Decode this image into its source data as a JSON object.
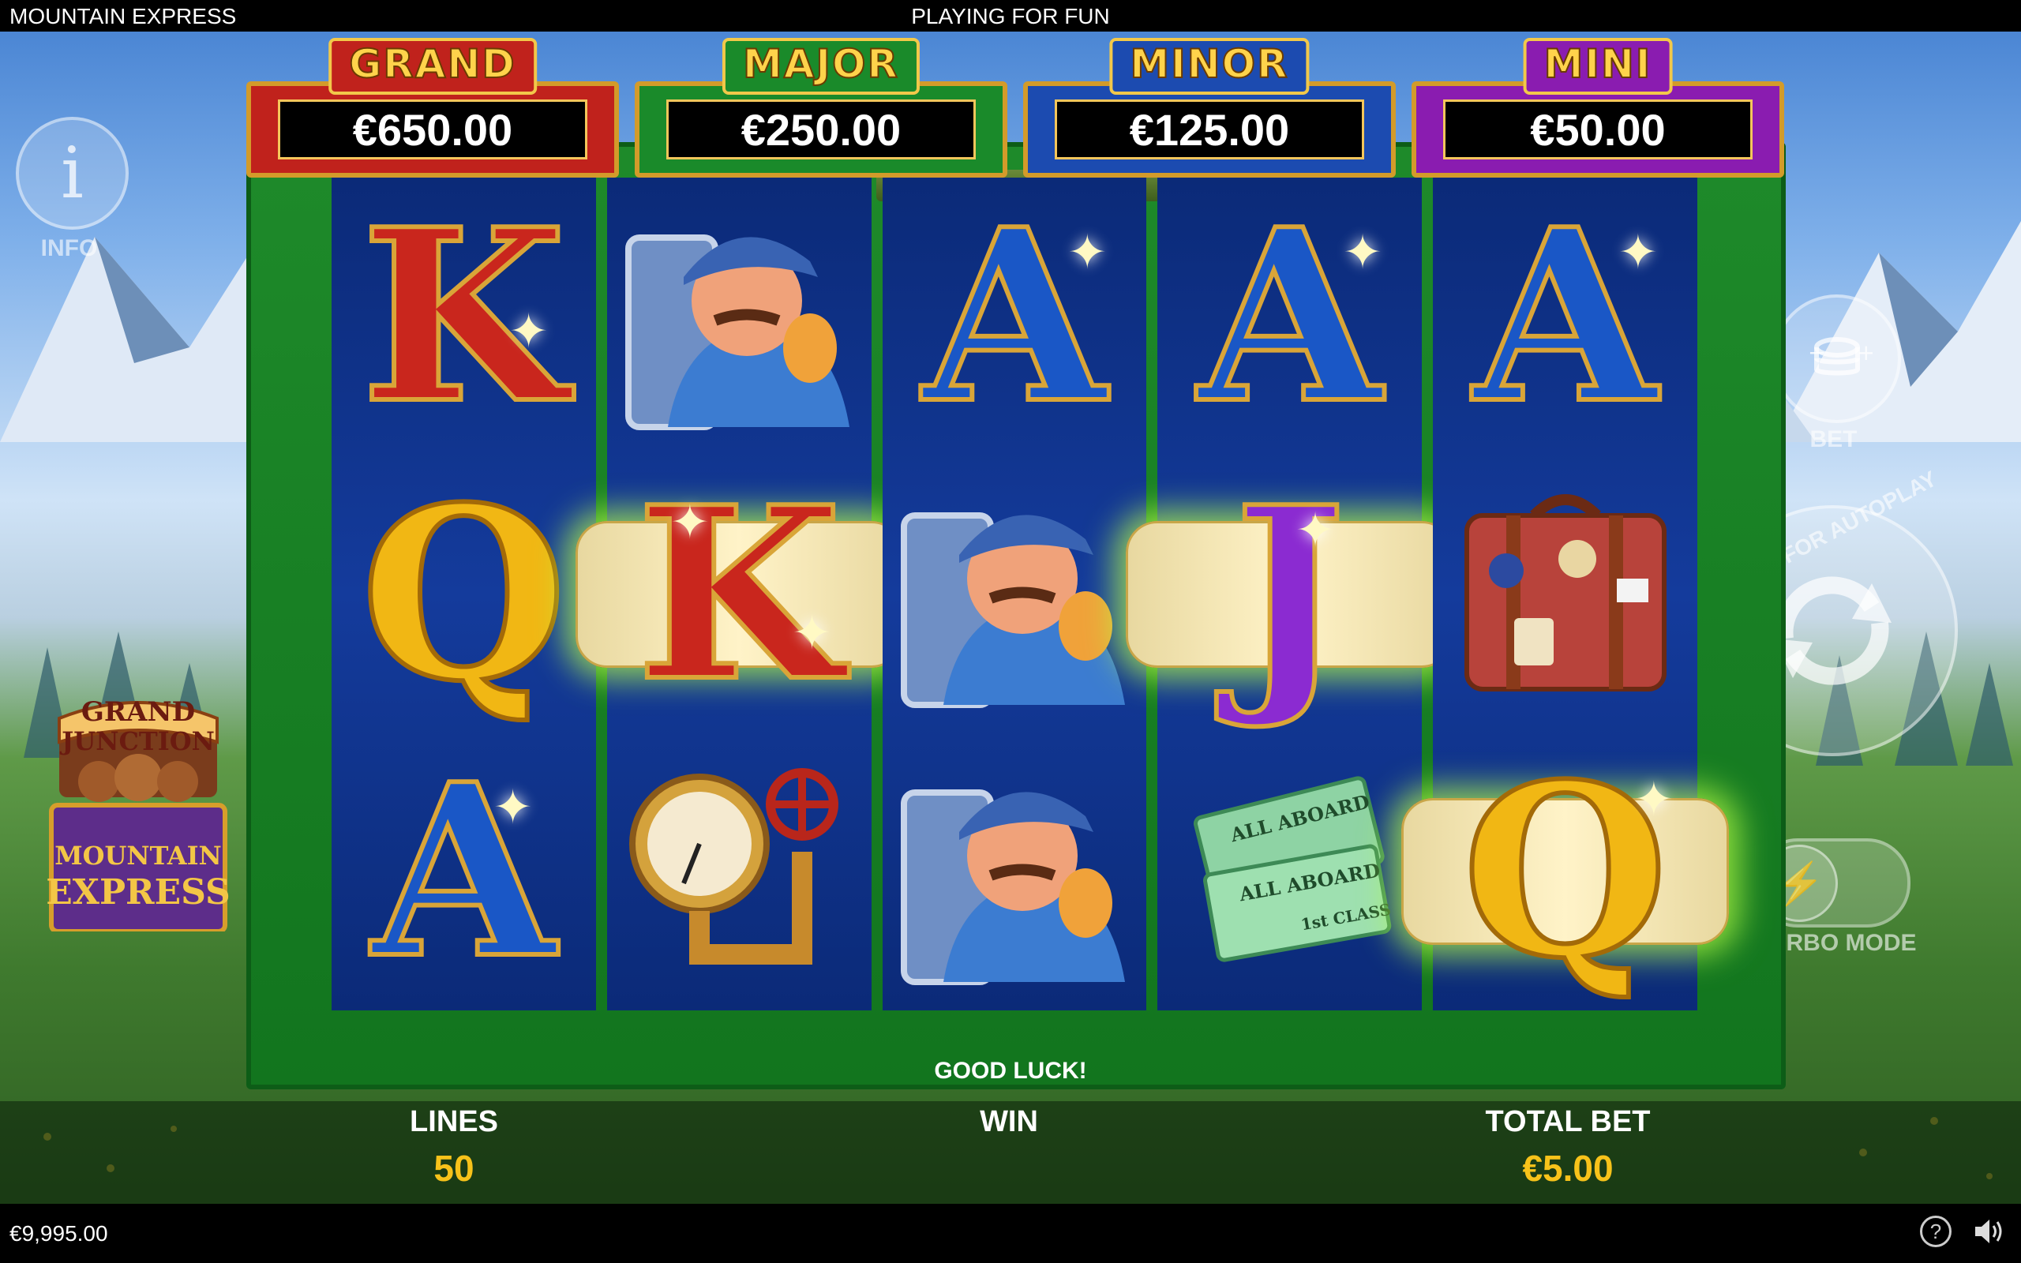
{
  "header": {
    "title": "MOUNTAIN EXPRESS",
    "mode": "PLAYING FOR FUN"
  },
  "jackpots": [
    {
      "label": "GRAND",
      "amount": "€650.00",
      "color": "#c0221c"
    },
    {
      "label": "MAJOR",
      "amount": "€250.00",
      "color": "#1a8a2a"
    },
    {
      "label": "MINOR",
      "amount": "€125.00",
      "color": "#1c4bb0"
    },
    {
      "label": "MINI",
      "amount": "€50.00",
      "color": "#8a1cb0"
    }
  ],
  "side": {
    "info_label": "INFO",
    "bet_label": "BET",
    "autoplay_label": "HOLD FOR AUTOPLAY",
    "turbo_label": "TURBO MODE"
  },
  "logo": {
    "line1": "GRAND",
    "line2": "JUNCTION",
    "line3": "MOUNTAIN",
    "line4": "EXPRESS"
  },
  "reels": [
    [
      "K",
      "Q",
      "A"
    ],
    [
      "engineer",
      "K",
      "pressure-gauge"
    ],
    [
      "A",
      "engineer",
      "engineer"
    ],
    [
      "A",
      "J",
      "tickets"
    ],
    [
      "A",
      "suitcase",
      "Q"
    ]
  ],
  "symbols": {
    "tickets_text_1": "ALL ABOARD",
    "tickets_text_2": "ALL ABOARD",
    "tickets_class": "1st CLASS"
  },
  "message": "GOOD LUCK!",
  "stats": {
    "lines_label": "LINES",
    "lines_value": "50",
    "win_label": "WIN",
    "total_bet_label": "TOTAL BET",
    "total_bet_value": "€5.00"
  },
  "footer": {
    "balance": "€9,995.00",
    "help_icon": "question-icon",
    "sound_icon": "speaker-icon"
  },
  "colors": {
    "frame": "#1e8a2a",
    "reel_bg": "#143b9c",
    "value_text": "#f7c21a"
  }
}
